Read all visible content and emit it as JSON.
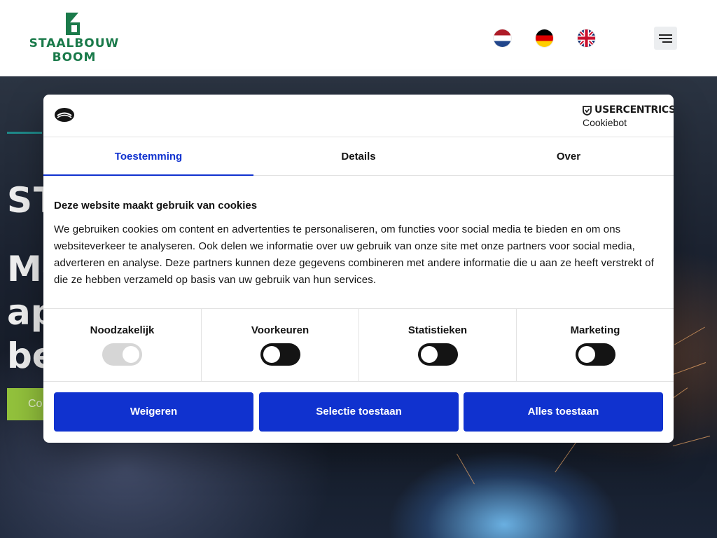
{
  "header": {
    "logo": {
      "line1": "STAALBOUW",
      "line2": "BOOM",
      "color": "#1a7a4a"
    },
    "languages": [
      {
        "code": "nl",
        "icon": "flag-netherlands-icon"
      },
      {
        "code": "de",
        "icon": "flag-germany-icon"
      },
      {
        "code": "en",
        "icon": "flag-uk-icon"
      }
    ],
    "menu_icon": "hamburger-menu-icon"
  },
  "hero": {
    "big_text": "ST",
    "heading_lines": [
      "Mo",
      "ap",
      "be"
    ],
    "cta_label": "Co",
    "cta_color": "#93c23c"
  },
  "cookie_dialog": {
    "brand": {
      "name": "USERCENTRICS",
      "sub": "Cookiebot"
    },
    "tabs": [
      {
        "label": "Toestemming",
        "active": true
      },
      {
        "label": "Details",
        "active": false
      },
      {
        "label": "Over",
        "active": false
      }
    ],
    "title": "Deze website maakt gebruik van cookies",
    "body": "We gebruiken cookies om content en advertenties te personaliseren, om functies voor social media te bieden en om ons websiteverkeer te analyseren. Ook delen we informatie over uw gebruik van onze site met onze partners voor social media, adverteren en analyse. Deze partners kunnen deze gegevens combineren met andere informatie die u aan ze heeft verstrekt of die ze hebben verzameld op basis van uw gebruik van hun services.",
    "toggles": [
      {
        "label": "Noodzakelijk",
        "checked": true,
        "disabled": true
      },
      {
        "label": "Voorkeuren",
        "checked": false,
        "disabled": false
      },
      {
        "label": "Statistieken",
        "checked": false,
        "disabled": false
      },
      {
        "label": "Marketing",
        "checked": false,
        "disabled": false
      }
    ],
    "buttons": {
      "deny": "Weigeren",
      "selection": "Selectie toestaan",
      "allow_all": "Alles toestaan"
    },
    "accent_color": "#1032cf"
  }
}
